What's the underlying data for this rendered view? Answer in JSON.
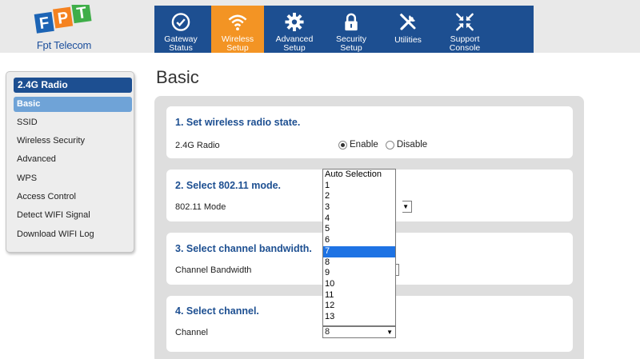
{
  "logo": {
    "marks": "FPT",
    "brand": "Fpt Telecom"
  },
  "nav": [
    {
      "label": "Gateway\nStatus",
      "icon": "check-circle-icon"
    },
    {
      "label": "Wireless\nSetup",
      "icon": "wifi-icon",
      "active": true
    },
    {
      "label": "Advanced\nSetup",
      "icon": "gear-icon"
    },
    {
      "label": "Security\nSetup",
      "icon": "lock-icon"
    },
    {
      "label": "Utilities",
      "icon": "tools-icon"
    },
    {
      "label": "Support\nConsole",
      "icon": "compress-arrows-icon"
    }
  ],
  "sidebar": {
    "header": "2.4G Radio",
    "items": [
      "Basic",
      "SSID",
      "Wireless Security",
      "Advanced",
      "WPS",
      "Access Control",
      "Detect WIFI Signal",
      "Download WIFI Log"
    ]
  },
  "page": {
    "title": "Basic",
    "sections": [
      {
        "title": "1. Set wireless radio state.",
        "label": "2.4G Radio",
        "options": [
          "Enable",
          "Disable"
        ],
        "selected": "Enable"
      },
      {
        "title": "2. Select 802.11 mode.",
        "label": "802.11 Mode"
      },
      {
        "title": "3. Select channel bandwidth.",
        "label": "Channel Bandwidth"
      },
      {
        "title": "4. Select channel.",
        "label": "Channel",
        "value": "8"
      }
    ]
  },
  "channel_dropdown": {
    "options": [
      "Auto Selection",
      "1",
      "2",
      "3",
      "4",
      "5",
      "6",
      "7",
      "8",
      "9",
      "10",
      "11",
      "12",
      "13"
    ],
    "highlighted": "7"
  },
  "colors": {
    "accent": "#1d4f91",
    "active_tab": "#f39424",
    "sidebar_active": "#6fa3d7",
    "highlight": "#1e73e4"
  }
}
